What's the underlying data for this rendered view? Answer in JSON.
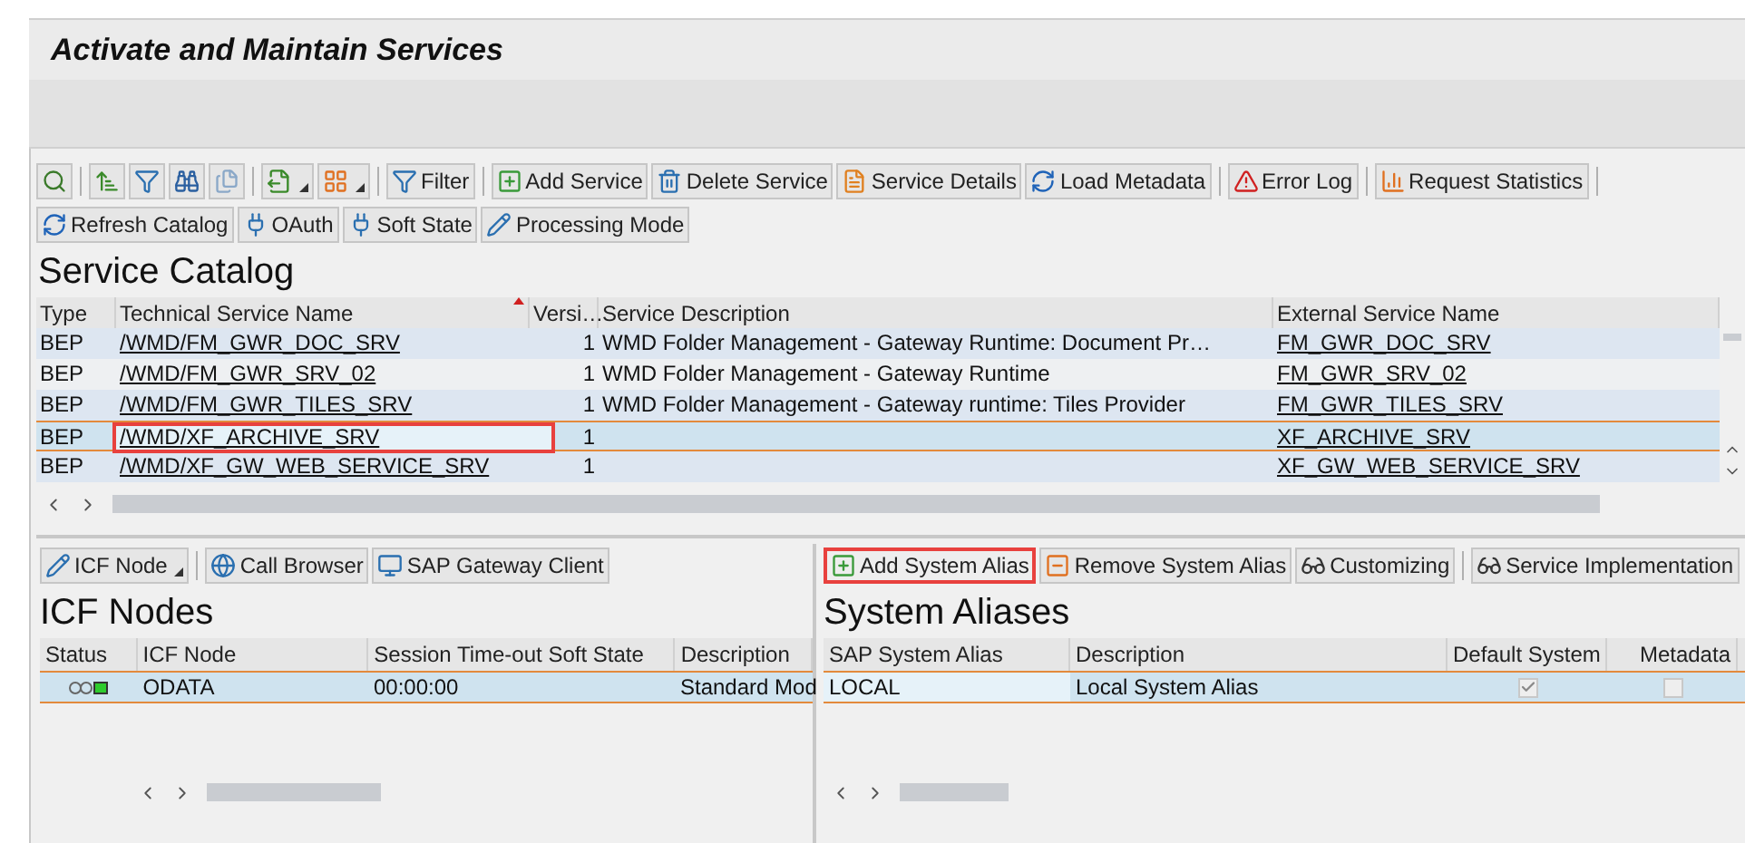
{
  "window": {
    "title": "Activate and Maintain Services"
  },
  "catalog_toolbar": [
    {
      "kind": "icon",
      "dropdown": false
    },
    {
      "kind": "separator"
    },
    {
      "kind": "icon",
      "dropdown": false
    },
    {
      "kind": "icon",
      "dropdown": false
    },
    {
      "kind": "icon",
      "dropdown": false
    },
    {
      "kind": "icon",
      "dropdown": false
    },
    {
      "kind": "separator"
    },
    {
      "kind": "icon",
      "dropdown": true
    },
    {
      "kind": "icon",
      "dropdown": true
    },
    {
      "kind": "separator"
    },
    {
      "kind": "text",
      "label": "Filter",
      "dropdown": false
    },
    {
      "kind": "separator"
    },
    {
      "kind": "text",
      "label": "Add Service",
      "dropdown": false
    },
    {
      "kind": "text",
      "label": "Delete Service",
      "dropdown": false
    },
    {
      "kind": "text",
      "label": "Service Details",
      "dropdown": false
    },
    {
      "kind": "text",
      "label": "Load Metadata",
      "dropdown": false
    },
    {
      "kind": "separator"
    },
    {
      "kind": "text",
      "label": "Error Log",
      "dropdown": false
    },
    {
      "kind": "separator"
    },
    {
      "kind": "text",
      "label": "Request Statistics",
      "dropdown": false
    },
    {
      "kind": "separator"
    }
  ],
  "catalog_toolbar_2": [
    {
      "kind": "text",
      "label": "Refresh Catalog",
      "dropdown": false
    },
    {
      "kind": "text",
      "label": "OAuth",
      "dropdown": false
    },
    {
      "kind": "text",
      "label": "Soft State",
      "dropdown": false
    },
    {
      "kind": "text",
      "label": "Processing Mode",
      "dropdown": false
    }
  ],
  "service_catalog": {
    "title": "Service Catalog",
    "columns": [
      {
        "label": "Type",
        "sorted": false
      },
      {
        "label": "Technical Service Name",
        "sorted": true
      },
      {
        "label": "Versi…",
        "sorted": false
      },
      {
        "label": "Service Description",
        "sorted": false
      },
      {
        "label": "External Service Name",
        "sorted": false
      }
    ],
    "rows": [
      {
        "type": "BEP",
        "technical_name": "/WMD/FM_GWR_DOC_SRV",
        "version": "1",
        "description": "WMD Folder Management - Gateway Runtime: Document Pr…",
        "external_name": "FM_GWR_DOC_SRV",
        "selected": false,
        "highlighted": false
      },
      {
        "type": "BEP",
        "technical_name": "/WMD/FM_GWR_SRV_02",
        "version": "1",
        "description": "WMD Folder Management - Gateway Runtime",
        "external_name": "FM_GWR_SRV_02",
        "selected": false,
        "highlighted": false
      },
      {
        "type": "BEP",
        "technical_name": "/WMD/FM_GWR_TILES_SRV",
        "version": "1",
        "description": "WMD Folder Management - Gateway runtime: Tiles Provider",
        "external_name": "FM_GWR_TILES_SRV",
        "selected": false,
        "highlighted": false
      },
      {
        "type": "BEP",
        "technical_name": "/WMD/XF_ARCHIVE_SRV",
        "version": "1",
        "description": "",
        "external_name": "XF_ARCHIVE_SRV",
        "selected": true,
        "highlighted": true
      },
      {
        "type": "BEP",
        "technical_name": "/WMD/XF_GW_WEB_SERVICE_SRV",
        "version": "1",
        "description": "",
        "external_name": "XF_GW_WEB_SERVICE_SRV",
        "selected": false,
        "highlighted": false
      }
    ]
  },
  "icf_toolbar": [
    {
      "kind": "text",
      "label": "ICF Node",
      "dropdown": true
    },
    {
      "kind": "separator"
    },
    {
      "kind": "text",
      "label": "Call Browser",
      "dropdown": false
    },
    {
      "kind": "text",
      "label": "SAP Gateway Client",
      "dropdown": false
    }
  ],
  "icf_nodes": {
    "title": "ICF Nodes",
    "columns": [
      "Status",
      "ICF Node",
      "Session Time-out Soft State",
      "Description"
    ],
    "rows": [
      {
        "icf_node": "ODATA",
        "timeout": "00:00:00",
        "description": "Standard Mod",
        "selected": true
      }
    ]
  },
  "alias_toolbar": [
    {
      "kind": "text",
      "label": "Add System Alias",
      "dropdown": false,
      "highlighted": true
    },
    {
      "kind": "text",
      "label": "Remove System Alias",
      "dropdown": false,
      "highlighted": false
    },
    {
      "kind": "text",
      "label": "Customizing",
      "dropdown": false,
      "highlighted": false
    },
    {
      "kind": "separator"
    },
    {
      "kind": "text",
      "label": "Service Implementation",
      "dropdown": false,
      "highlighted": false
    }
  ],
  "system_aliases": {
    "title": "System Aliases",
    "columns": [
      "SAP System Alias",
      "Description",
      "Default System",
      "Metadata"
    ],
    "rows": [
      {
        "alias": "LOCAL",
        "description": "Local System Alias",
        "default_system": true,
        "metadata": false,
        "selected": true
      }
    ]
  }
}
